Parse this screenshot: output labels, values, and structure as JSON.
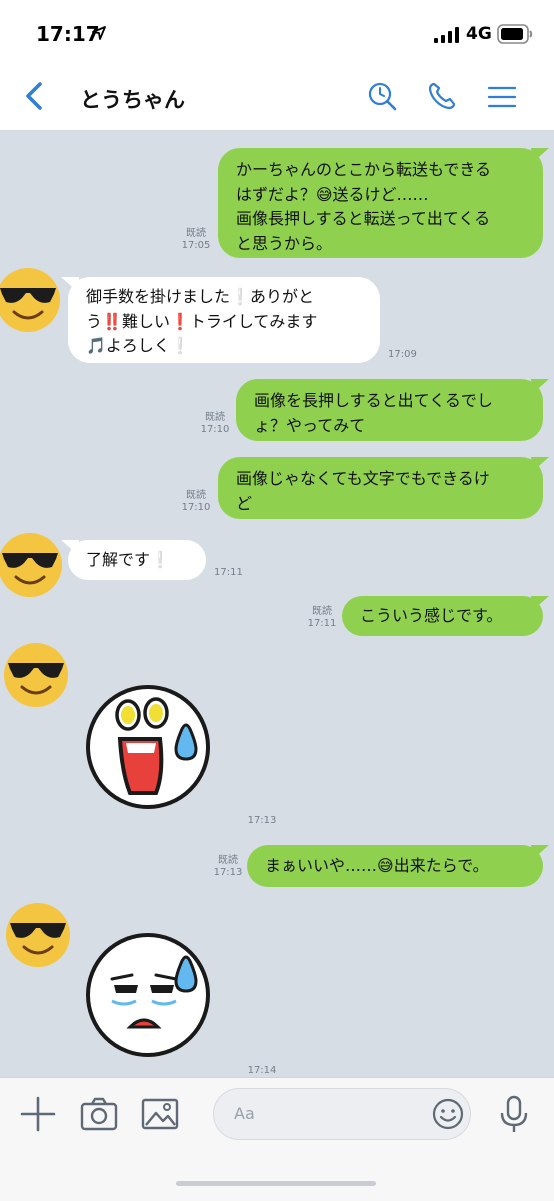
{
  "status_bar": {
    "time": "17:17",
    "network": "4G"
  },
  "header": {
    "title": "とうちゃん"
  },
  "messages": [
    {
      "side": "out",
      "lines": [
        "かーちゃんのとこから転送もできる",
        "はずだよ？😅送るけど……",
        "画像長押しすると転送って出てくる",
        "と思うから。"
      ],
      "read": "既読",
      "time": "17:05"
    },
    {
      "side": "in",
      "lines": [
        "御手数を掛けました❕ありがと",
        "う‼️難しい❗トライしてみます",
        "🎵よろしく❕"
      ],
      "time": "17:09"
    },
    {
      "side": "out",
      "lines": [
        "画像を長押しすると出てくるでし",
        "ょ？やってみて"
      ],
      "read": "既読",
      "time": "17:10"
    },
    {
      "side": "out",
      "lines": [
        "画像じゃなくても文字でもできるけ",
        "ど"
      ],
      "read": "既読",
      "time": "17:10"
    },
    {
      "side": "in",
      "lines": [
        "了解です❕"
      ],
      "time": "17:11"
    },
    {
      "side": "out",
      "lines": [
        "こういう感じです。"
      ],
      "read": "既読",
      "time": "17:11"
    },
    {
      "side": "in",
      "sticker": "shocked-face-sticker",
      "time": "17:13"
    },
    {
      "side": "out",
      "lines": [
        "まぁいいや……😅出来たらで。"
      ],
      "read": "既読",
      "time": "17:13"
    },
    {
      "side": "in",
      "sticker": "sad-face-sticker",
      "time": "17:14"
    }
  ],
  "input": {
    "placeholder": "Aa"
  },
  "icons": {
    "back": "chevron-left-icon",
    "search": "search-icon",
    "call": "phone-icon",
    "menu": "menu-icon",
    "add": "plus-icon",
    "camera": "camera-icon",
    "image": "image-icon",
    "emoji": "smile-icon",
    "voice": "microphone-icon"
  },
  "colors": {
    "accent": "#3b82d6",
    "outgoing_bubble": "#8fd14f",
    "incoming_bubble": "#ffffff",
    "chat_background": "#d6dde5"
  }
}
